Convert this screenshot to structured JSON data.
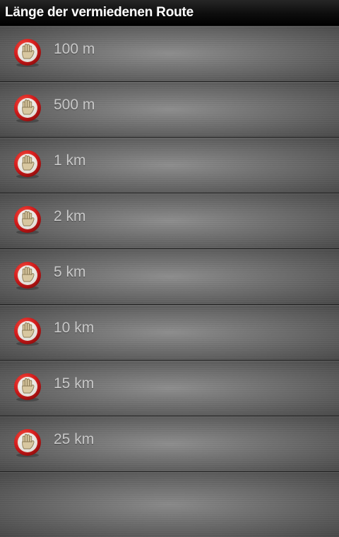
{
  "header": {
    "title": "Länge der vermiedenen Route"
  },
  "list": {
    "icon": "stop-hand-icon",
    "items": [
      {
        "label": "100 m"
      },
      {
        "label": "500 m"
      },
      {
        "label": "1 km"
      },
      {
        "label": "2 km"
      },
      {
        "label": "5 km"
      },
      {
        "label": "10 km"
      },
      {
        "label": "15 km"
      },
      {
        "label": "25 km"
      }
    ]
  },
  "colors": {
    "icon_ring": "#d21c1c",
    "icon_face": "#f4f1ec",
    "hand": "#d8c7a0",
    "label_text": "#c8c8c8",
    "title_text": "#ffffff"
  }
}
